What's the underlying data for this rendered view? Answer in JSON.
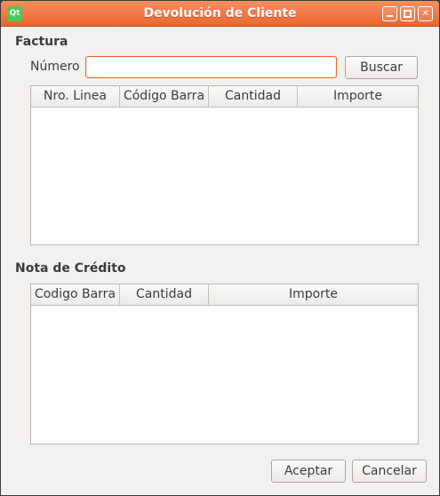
{
  "window": {
    "title": "Devolución de Cliente",
    "app_icon_text": "Qt"
  },
  "factura": {
    "section_title": "Factura",
    "numero_label": "Número",
    "numero_value": "",
    "buscar_label": "Buscar",
    "table": {
      "columns": [
        "Nro. Linea",
        "Código Barra",
        "Cantidad",
        "Importe"
      ],
      "rows": []
    }
  },
  "nota_credito": {
    "section_title": "Nota de Crédito",
    "table": {
      "columns": [
        "Codigo Barra",
        "Cantidad",
        "Importe"
      ],
      "rows": []
    }
  },
  "actions": {
    "aceptar_label": "Aceptar",
    "cancelar_label": "Cancelar"
  },
  "colors": {
    "accent": "#f07746",
    "focus_border": "#e9682d",
    "window_bg": "#f2f1f0"
  }
}
